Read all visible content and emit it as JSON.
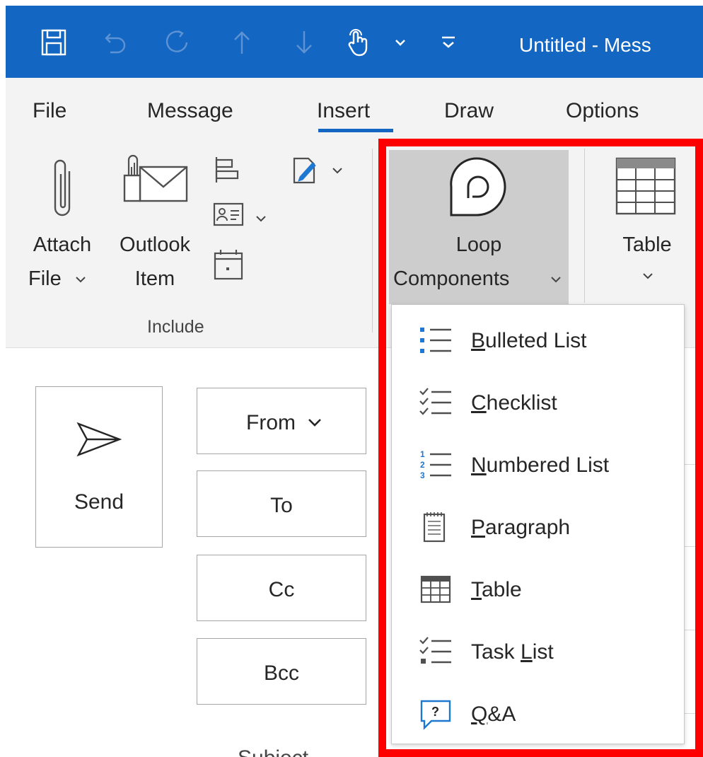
{
  "titlebar": {
    "title": "Untitled  -  Mess",
    "icons": [
      "save-icon",
      "undo-icon",
      "redo-icon",
      "up-arrow-icon",
      "down-arrow-icon",
      "touch-mode-icon",
      "chevron-down-icon",
      "customize-qat-icon"
    ]
  },
  "ribbon": {
    "tabs": [
      {
        "label": "File"
      },
      {
        "label": "Message"
      },
      {
        "label": "Insert",
        "active": true
      },
      {
        "label": "Draw"
      },
      {
        "label": "Options"
      }
    ],
    "include_group": {
      "label": "Include",
      "attach_file": {
        "line1": "Attach",
        "line2": "File"
      },
      "outlook_item": {
        "line1": "Outlook",
        "line2": "Item"
      }
    },
    "loop_components": {
      "line1": "Loop",
      "line2": "Components"
    },
    "table": {
      "label": "Table"
    }
  },
  "compose": {
    "send_label": "Send",
    "from_label": "From",
    "to_label": "To",
    "cc_label": "Cc",
    "bcc_label": "Bcc",
    "subject_label": "Subject"
  },
  "loop_menu": {
    "items": [
      {
        "icon": "bulleted-list-icon",
        "accel": "B",
        "rest": "ulleted List",
        "full": "Bulleted List"
      },
      {
        "icon": "checklist-icon",
        "accel": "C",
        "rest": "hecklist",
        "full": "Checklist"
      },
      {
        "icon": "numbered-list-icon",
        "accel": "N",
        "rest": "umbered List",
        "full": "Numbered List"
      },
      {
        "icon": "paragraph-icon",
        "accel": "P",
        "rest": "aragraph",
        "full": "Paragraph"
      },
      {
        "icon": "table-icon",
        "accel": "T",
        "rest": "able",
        "full": "Table"
      },
      {
        "icon": "task-list-icon",
        "pre": "Task ",
        "accel": "L",
        "rest": "ist",
        "full": "Task List"
      },
      {
        "icon": "qa-icon",
        "accel": "Q",
        "rest": "&A",
        "full": "Q&A"
      }
    ]
  },
  "colors": {
    "titlebar": "#1366c1",
    "ribbon_bg": "#f3f3f3",
    "highlight_border": "#ff0000",
    "accent_blue": "#1e78d2"
  }
}
